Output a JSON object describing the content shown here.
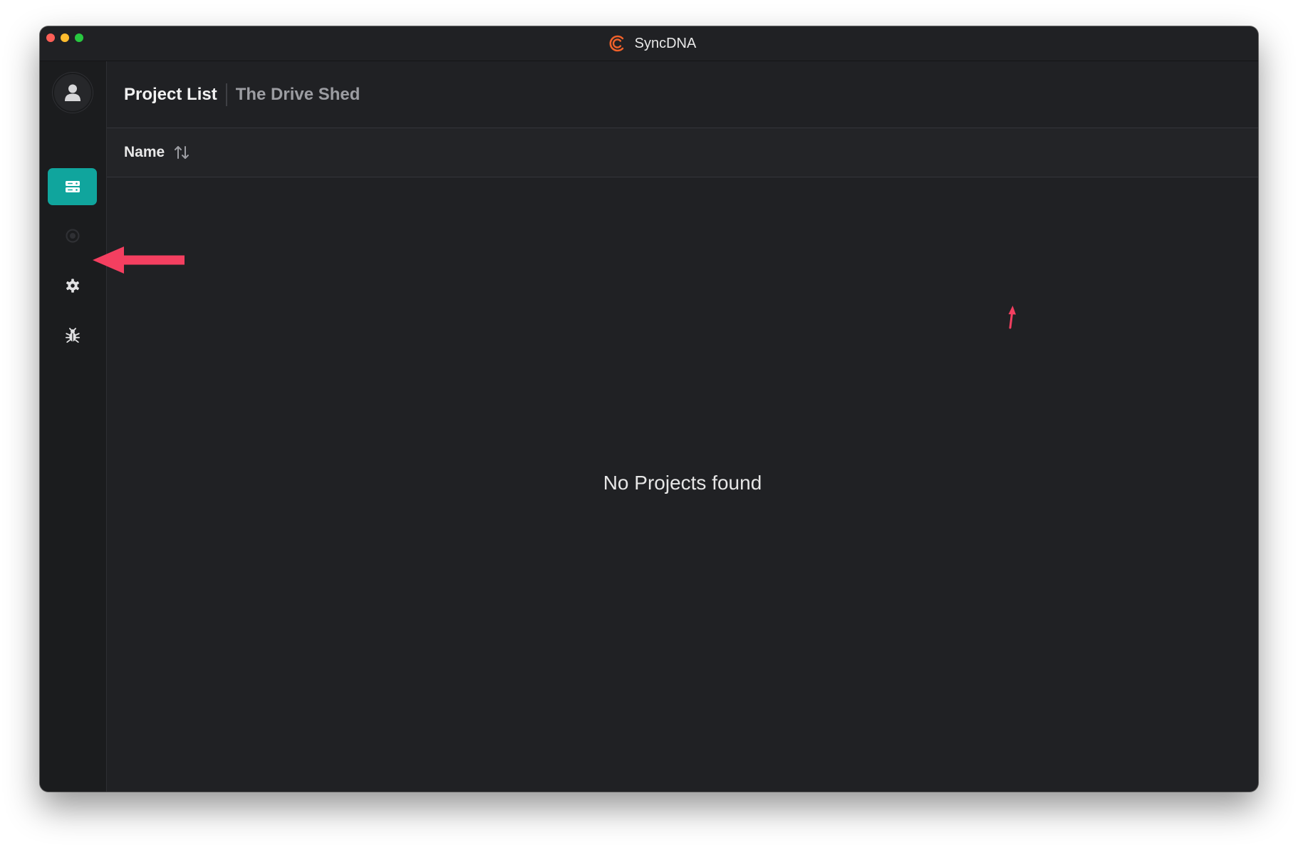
{
  "window": {
    "title": "SyncDNA",
    "logo_icon": "syncdna-logo-icon",
    "traffic_lights": [
      "close",
      "minimize",
      "zoom"
    ]
  },
  "sidebar": {
    "avatar_icon": "user-icon",
    "items": [
      {
        "name": "projects",
        "icon": "server-icon",
        "active": true
      },
      {
        "name": "status",
        "icon": "status-dot-icon",
        "active": false
      },
      {
        "name": "settings",
        "icon": "gear-icon",
        "active": false
      },
      {
        "name": "debug",
        "icon": "bug-icon",
        "active": false
      }
    ]
  },
  "header": {
    "title": "Project List",
    "subtitle": "The Drive Shed"
  },
  "table": {
    "columns": [
      {
        "label": "Name",
        "sort_icon": "sort-arrows-icon"
      }
    ]
  },
  "empty_state": {
    "message": "No Projects found"
  },
  "colors": {
    "accent": "#10a59d",
    "window_bg": "#202124",
    "annotation": "#f43f60",
    "logo": "#f0612a"
  }
}
